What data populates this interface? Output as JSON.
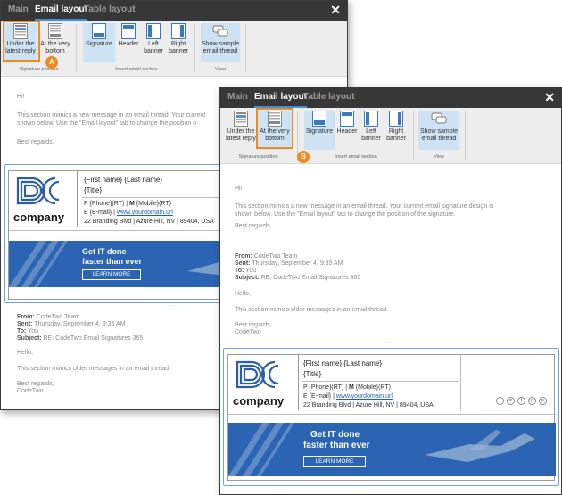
{
  "tabs": [
    "Main",
    "Email layout",
    "Table layout"
  ],
  "close_glyph": "✕",
  "ribbon": {
    "under_latest_reply": "Under the latest reply",
    "at_very_bottom": "At the very bottom",
    "signature": "Signature",
    "header": "Header",
    "left_banner": "Left banner",
    "right_banner": "Right banner",
    "show_sample": "Show sample email thread",
    "group_signature_position": "Signature position",
    "group_insert_section": "Insert email section",
    "group_view": "View"
  },
  "badges": {
    "a": "A",
    "b": "B"
  },
  "message": {
    "greeting": "Hi!",
    "body_a_line1": "This section mimics a new message in an email thread. Your current",
    "body_a_line2": "shown below. Use the \"Email layout\" tab to change the position o",
    "body_b_line1": "This section mimics a new message in an email thread. Your current email signature design is",
    "body_b_line2": "shown below. Use the \"Email layout\" tab to change the position of the signature.",
    "regards": "Best regards,"
  },
  "signature": {
    "name": "{First name} {Last name}",
    "title": "{Title}",
    "phone_p": "P {Phone}(RT)",
    "phone_sep": " | ",
    "phone_m": "M",
    "phone_mobile": " {Mobile}(RT)",
    "email_prefix": "E {E-mail} | ",
    "url": "www.yourdomain.url",
    "address": "22 Branding Blvd | Azure Hill, NV | 89404, USA",
    "logo_text": "company"
  },
  "banner": {
    "line1": "Get IT done",
    "line2": "faster than ever",
    "cta": "LEARN MORE"
  },
  "quoted": {
    "from_label": "From:",
    "from_value": " CodeTwo Team",
    "sent_label": "Sent:",
    "sent_value": " Thursday, September 4, 9:35 AM",
    "to_label": "To:",
    "to_value": " You",
    "subject_label": "Subject:",
    "subject_value": " RE: CodeTwo Email Signatures 365",
    "hello": "Hello,",
    "body": "This section mimics older messages in an email thread.",
    "regards": "Best regards,",
    "signoff": "CodeTwo"
  },
  "dots": "....",
  "social": [
    "f",
    "in",
    "t",
    "yt",
    "p"
  ],
  "colors": {
    "accent": "#ef8a22",
    "tab_underline": "#3d8fdc",
    "banner": "#2c64b4",
    "logo_blue": "#2b5ea7"
  }
}
